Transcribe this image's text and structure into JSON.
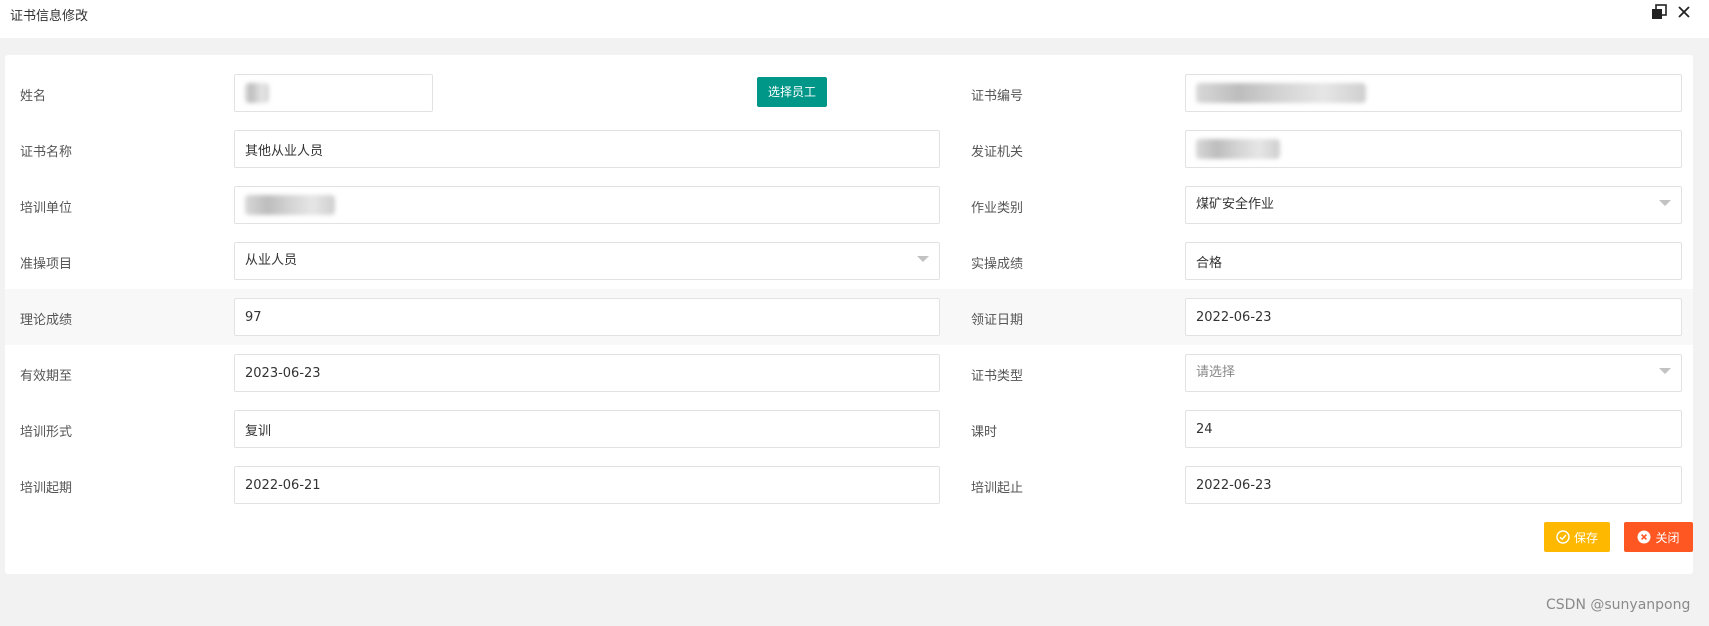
{
  "window": {
    "title": "证书信息修改",
    "restore_icon": "restore-window-icon",
    "close_icon": "close-icon"
  },
  "form": {
    "rows": [
      {
        "left": {
          "label": "姓名",
          "value": "",
          "redacted": true
        },
        "select_employee_label": "选择员工",
        "right": {
          "label": "证书编号",
          "value": "",
          "redacted": true
        }
      },
      {
        "left": {
          "label": "证书名称",
          "value": "其他从业人员"
        },
        "right": {
          "label": "发证机关",
          "value": "",
          "redacted": true
        }
      },
      {
        "left": {
          "label": "培训单位",
          "value": "",
          "redacted": true
        },
        "right": {
          "label": "作业类别",
          "value": "煤矿安全作业",
          "type": "select"
        }
      },
      {
        "left": {
          "label": "准操项目",
          "value": "从业人员",
          "type": "select"
        },
        "right": {
          "label": "实操成绩",
          "value": "合格"
        }
      },
      {
        "left": {
          "label": "理论成绩",
          "value": "97"
        },
        "right": {
          "label": "领证日期",
          "value": "2022-06-23"
        }
      },
      {
        "left": {
          "label": "有效期至",
          "value": "2023-06-23"
        },
        "right": {
          "label": "证书类型",
          "placeholder": "请选择",
          "type": "select"
        }
      },
      {
        "left": {
          "label": "培训形式",
          "value": "复训"
        },
        "right": {
          "label": "课时",
          "value": "24"
        }
      },
      {
        "left": {
          "label": "培训起期",
          "value": "2022-06-21"
        },
        "right": {
          "label": "培训起止",
          "value": "2022-06-23"
        }
      }
    ]
  },
  "actions": {
    "save_label": "保存",
    "close_label": "关闭",
    "save_icon": "check-circle-icon",
    "close_icon": "close-circle-icon",
    "save_color": "#FFB800",
    "close_color": "#FF5722"
  },
  "colors": {
    "primary_button": "#009688",
    "background": "#F2F2F2"
  },
  "watermark": "CSDN @sunyanpong"
}
